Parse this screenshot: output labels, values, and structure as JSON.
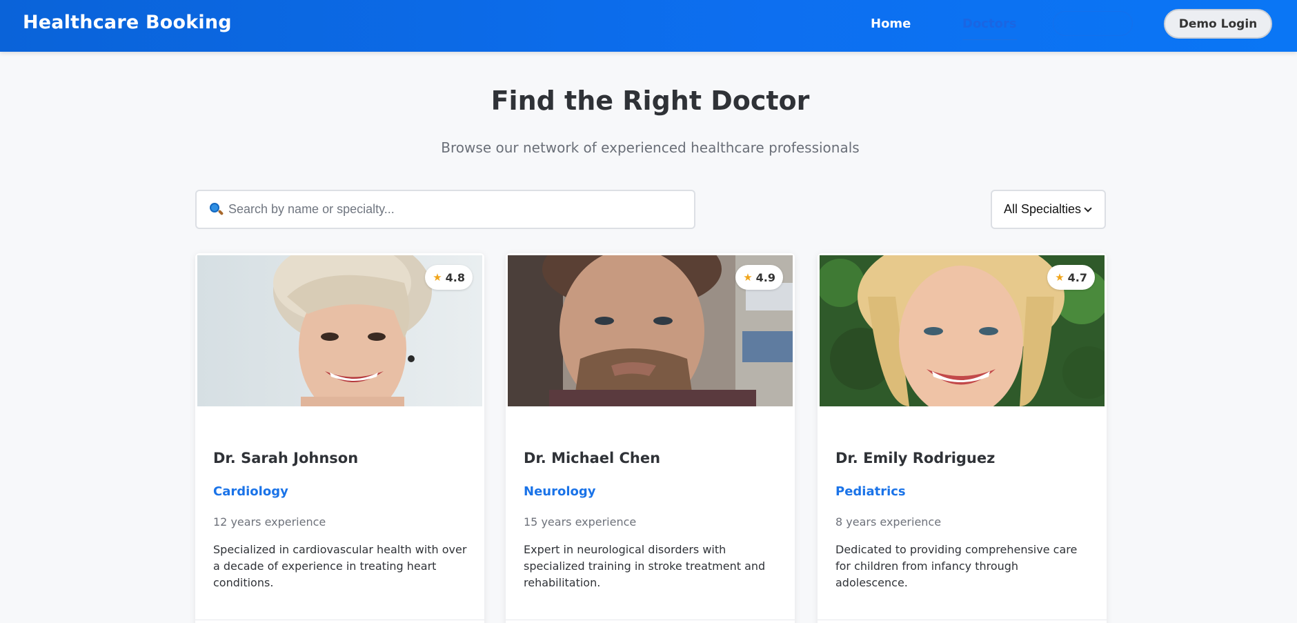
{
  "navbar": {
    "brand": "Healthcare Booking",
    "links": [
      "Home",
      "Doctors"
    ],
    "login_label": "Demo Login"
  },
  "hero": {
    "title": "Find the Right Doctor",
    "subtitle": "Browse our network of experienced healthcare professionals"
  },
  "search": {
    "icon": "magnifier-icon",
    "placeholder": "Search by name or specialty...",
    "value": ""
  },
  "filter": {
    "selected": "All Specialties"
  },
  "doctors": [
    {
      "name": "Dr. Sarah Johnson",
      "specialty": "Cardiology",
      "experience": "12 years experience",
      "rating": "4.8",
      "description": "Specialized in cardiovascular health with over a decade of experience in treating heart conditions."
    },
    {
      "name": "Dr. Michael Chen",
      "specialty": "Neurology",
      "experience": "15 years experience",
      "rating": "4.9",
      "description": "Expert in neurological disorders with specialized training in stroke treatment and rehabilitation."
    },
    {
      "name": "Dr. Emily Rodriguez",
      "specialty": "Pediatrics",
      "experience": "8 years experience",
      "rating": "4.7",
      "description": "Dedicated to providing comprehensive care for children from infancy through adolescence."
    }
  ],
  "colors": {
    "nav_gradient_start": "#0a63d9",
    "nav_gradient_end": "#0a76f5",
    "accent": "#1a73e8",
    "star": "#f0a51c",
    "page_background": "#f7f8fa"
  }
}
